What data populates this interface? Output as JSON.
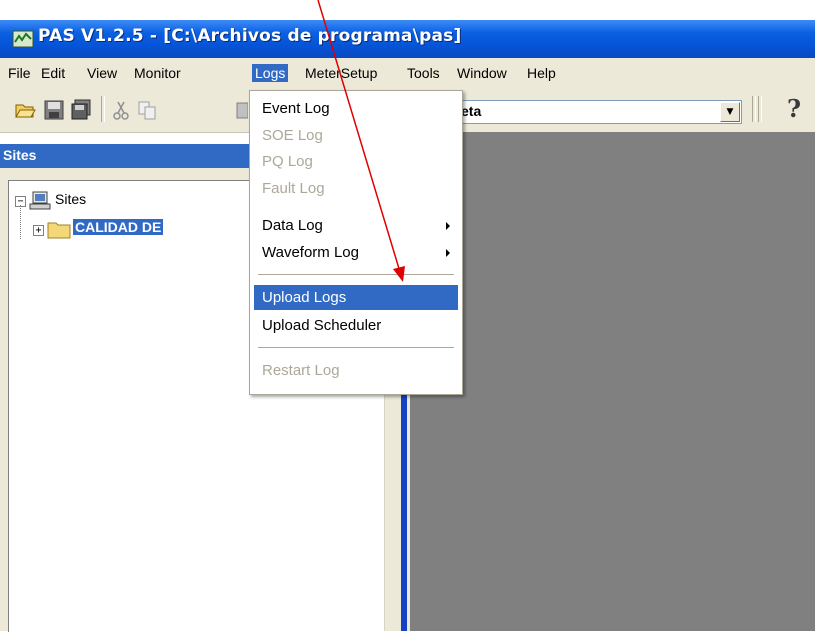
{
  "window": {
    "title": "PAS V1.2.5 - [C:\\Archivos de programa\\pas]"
  },
  "menubar": {
    "items": [
      {
        "label": "File"
      },
      {
        "label": "Edit"
      },
      {
        "label": "View"
      },
      {
        "label": "Monitor"
      },
      {
        "label": "Logs"
      },
      {
        "label": "MeterSetup"
      },
      {
        "label": "Tools"
      },
      {
        "label": "Window"
      },
      {
        "label": "Help"
      }
    ]
  },
  "toolbar": {
    "combo_value": "eta",
    "icons": [
      "open-folder-icon",
      "save-icon",
      "save-all-icon",
      "cut-icon",
      "copy-icon",
      "paste-icon",
      "help-icon"
    ]
  },
  "sites_panel": {
    "title": "Sites",
    "tree": {
      "root": {
        "label": "Sites",
        "expander": "−"
      },
      "child": {
        "label": "CALIDAD DE",
        "expander": "+"
      }
    }
  },
  "logs_menu": {
    "items": [
      {
        "label": "Event Log",
        "enabled": true
      },
      {
        "label": "SOE Log",
        "enabled": false
      },
      {
        "label": "PQ Log",
        "enabled": false
      },
      {
        "label": "Fault Log",
        "enabled": false
      },
      {
        "label": "Data Log",
        "enabled": true,
        "submenu": true
      },
      {
        "label": "Waveform Log",
        "enabled": true,
        "submenu": true
      },
      {
        "label": "Upload Logs",
        "enabled": true,
        "highlighted": true
      },
      {
        "label": "Upload Scheduler",
        "enabled": true
      },
      {
        "label": "Restart Log",
        "enabled": false
      }
    ]
  },
  "colors": {
    "titlebar": "#0553d6",
    "highlight": "#316ac5",
    "menubar": "#ece9d8",
    "mdi_background": "#808080",
    "annotation_arrow": "#e00000"
  }
}
